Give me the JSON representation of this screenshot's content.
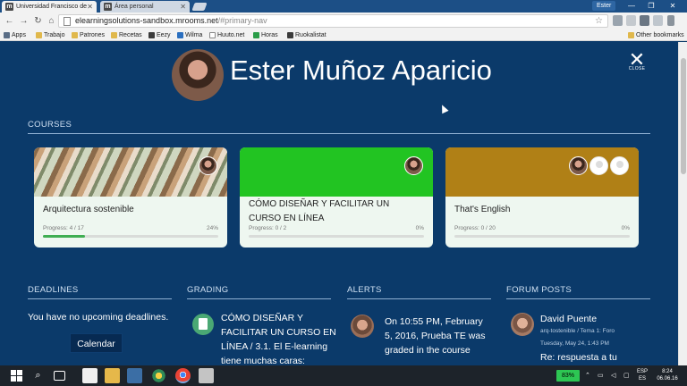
{
  "browser": {
    "tabs": [
      {
        "label": "Universidad Francisco de",
        "favicon": "m",
        "active": true
      },
      {
        "label": "Área personal",
        "favicon": "m",
        "active": false
      }
    ],
    "profile_name": "Ester",
    "url_host": "elearningsolutions-sandbox.mrooms.net",
    "url_path": "/#primary-nav",
    "bookmarks": [
      "Apps",
      "Trabajo",
      "Patrones",
      "Recetas",
      "Eezy",
      "Wilma",
      "Huuto.net",
      "Horas",
      "Ruokalistat"
    ],
    "other_bookmarks": "Other bookmarks"
  },
  "profile": {
    "name": "Ester Muñoz Aparicio",
    "close_label": "CLOSE"
  },
  "courses": {
    "heading": "COURSES",
    "items": [
      {
        "title": "Arquitectura sostenible",
        "progress_label": "Progress: 4 / 17",
        "percent_label": "24%",
        "progress": 0.24,
        "banner_color": "#b9c6a6"
      },
      {
        "title": "CÓMO DISEÑAR Y FACILITAR UN CURSO EN LÍNEA",
        "progress_label": "Progress: 0 / 2",
        "percent_label": "0%",
        "progress": 0,
        "banner_color": "#22c422"
      },
      {
        "title": "That's English",
        "progress_label": "Progress: 0 / 20",
        "percent_label": "0%",
        "progress": 0,
        "banner_color": "#b08016"
      }
    ]
  },
  "deadlines": {
    "heading": "DEADLINES",
    "message": "You have no upcoming deadlines.",
    "calendar_button": "Calendar"
  },
  "grading": {
    "heading": "GRADING",
    "text": "CÓMO DISEÑAR Y FACILITAR UN CURSO EN LÍNEA / 3.1. El E-learning tiene muchas caras:"
  },
  "alerts": {
    "heading": "ALERTS",
    "text": "On 10:55 PM, February 5, 2016, Prueba TE was graded in the course"
  },
  "forum": {
    "heading": "FORUM POSTS",
    "author": "David Puente",
    "meta": "arq-tostenible / Tema 1: Foro",
    "date": "Tuesday, May 24, 1:43 PM",
    "reply": "Re: respuesta a tu"
  },
  "taskbar": {
    "battery": "83%",
    "lang_top": "ESP",
    "lang_bottom": "ES",
    "time": "8:24",
    "date": "06.06.16"
  }
}
